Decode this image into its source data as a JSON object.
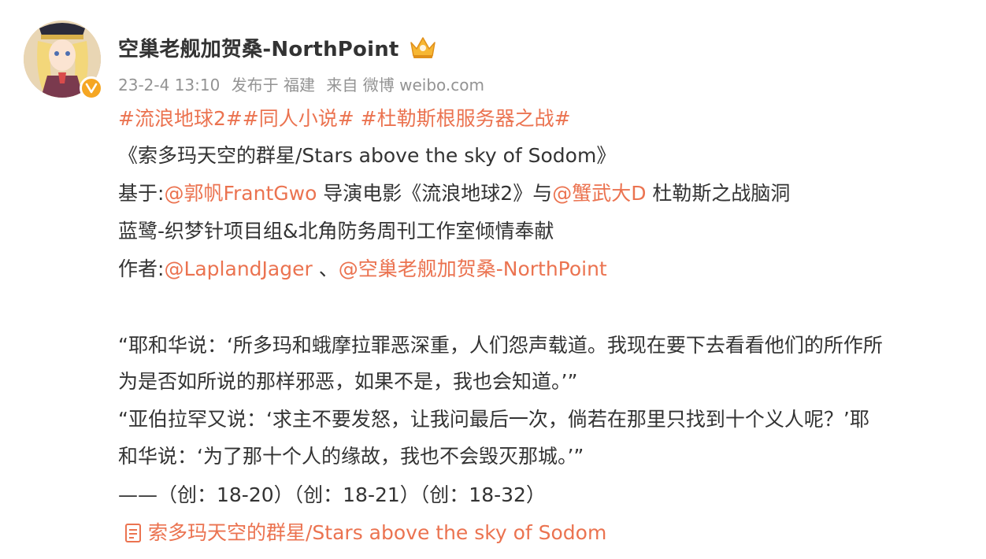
{
  "post": {
    "author": "空巢老舰加贺桑-NorthPoint",
    "timestamp": "23-2-4 13:10",
    "location": "发布于 福建",
    "source": "来自 微博 weibo.com"
  },
  "content": {
    "hashtags": "#流浪地球2##同人小说# #杜勒斯根服务器之战#",
    "title": "《索多玛天空的群星/Stars above the sky of Sodom》",
    "based_on_prefix": "基于:",
    "mention_1": "@郭帆FrantGwo",
    "based_on_mid": " 导演电影《流浪地球2》与",
    "mention_2": "@蟹武大D",
    "based_on_suffix": " 杜勒斯之战脑洞",
    "credits": "蓝鹭-织梦针项目组&北角防务周刊工作室倾情奉献",
    "authors_prefix": "作者:",
    "mention_3": "@LaplandJager",
    "authors_sep": " 、",
    "mention_4": "@空巢老舰加贺桑-NorthPoint",
    "quote_1a": "“耶和华说：‘所多玛和蛾摩拉罪恶深重，人们怨声载道。我现在要下去看看他们的所作所",
    "quote_1b": "为是否如所说的那样邪恶，如果不是，我也会知道。’”",
    "quote_2a": "“亚伯拉罕又说：‘求主不要发怒，让我问最后一次，倘若在那里只找到十个义人呢？’耶",
    "quote_2b": "和华说：‘为了那十个人的缘故，我也不会毁灭那城。’”",
    "citation": "——（创：18-20）（创：18-21）（创：18-32）",
    "article_link": "索多玛天空的群星/Stars above the sky of Sodom"
  },
  "icons": {
    "verified": "verified-badge-icon",
    "crown": "crown-icon",
    "article": "document-icon"
  },
  "colors": {
    "accent": "#eb7350",
    "text": "#333333",
    "meta": "#939393",
    "badge": "#f5a623"
  }
}
